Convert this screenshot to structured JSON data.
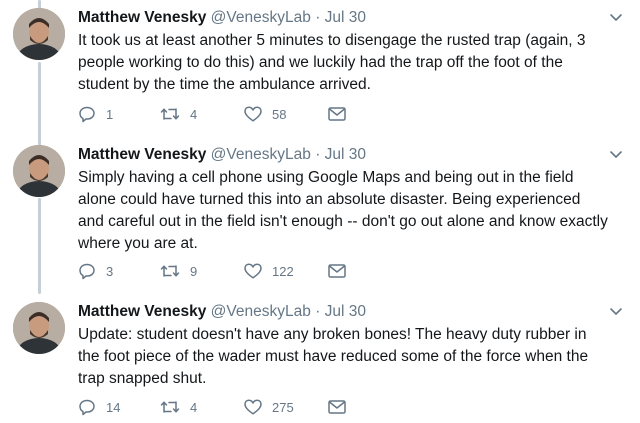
{
  "tweets": [
    {
      "name": "Matthew Venesky",
      "handle": "@VeneskyLab",
      "sep": "·",
      "time": "Jul 30",
      "text": "It took us at least another 5 minutes to disengage the rusted trap (again, 3 people working to do this) and we luckily had the trap off the foot of the student by the time the ambulance arrived.",
      "replies": "1",
      "retweets": "4",
      "likes": "58"
    },
    {
      "name": "Matthew Venesky",
      "handle": "@VeneskyLab",
      "sep": "·",
      "time": "Jul 30",
      "text": "Simply having a cell phone using Google Maps and being out in the field alone could have turned this into an absolute disaster. Being experienced and careful out in the field isn't enough -- don't go out alone and know exactly where you are at.",
      "replies": "3",
      "retweets": "9",
      "likes": "122"
    },
    {
      "name": "Matthew Venesky",
      "handle": "@VeneskyLab",
      "sep": "·",
      "time": "Jul 30",
      "text": "Update: student doesn't have any broken bones! The heavy duty rubber in the foot piece of the wader must have reduced some of the force when the trap snapped shut.",
      "replies": "14",
      "retweets": "4",
      "likes": "275"
    }
  ],
  "icons": {
    "reply": "reply-icon",
    "retweet": "retweet-icon",
    "like": "heart-icon",
    "dm": "envelope-icon",
    "menu": "chevron-down-icon"
  },
  "colors": {
    "text": "#14171a",
    "secondary": "#657786",
    "thread_line": "#c4cfd6"
  }
}
